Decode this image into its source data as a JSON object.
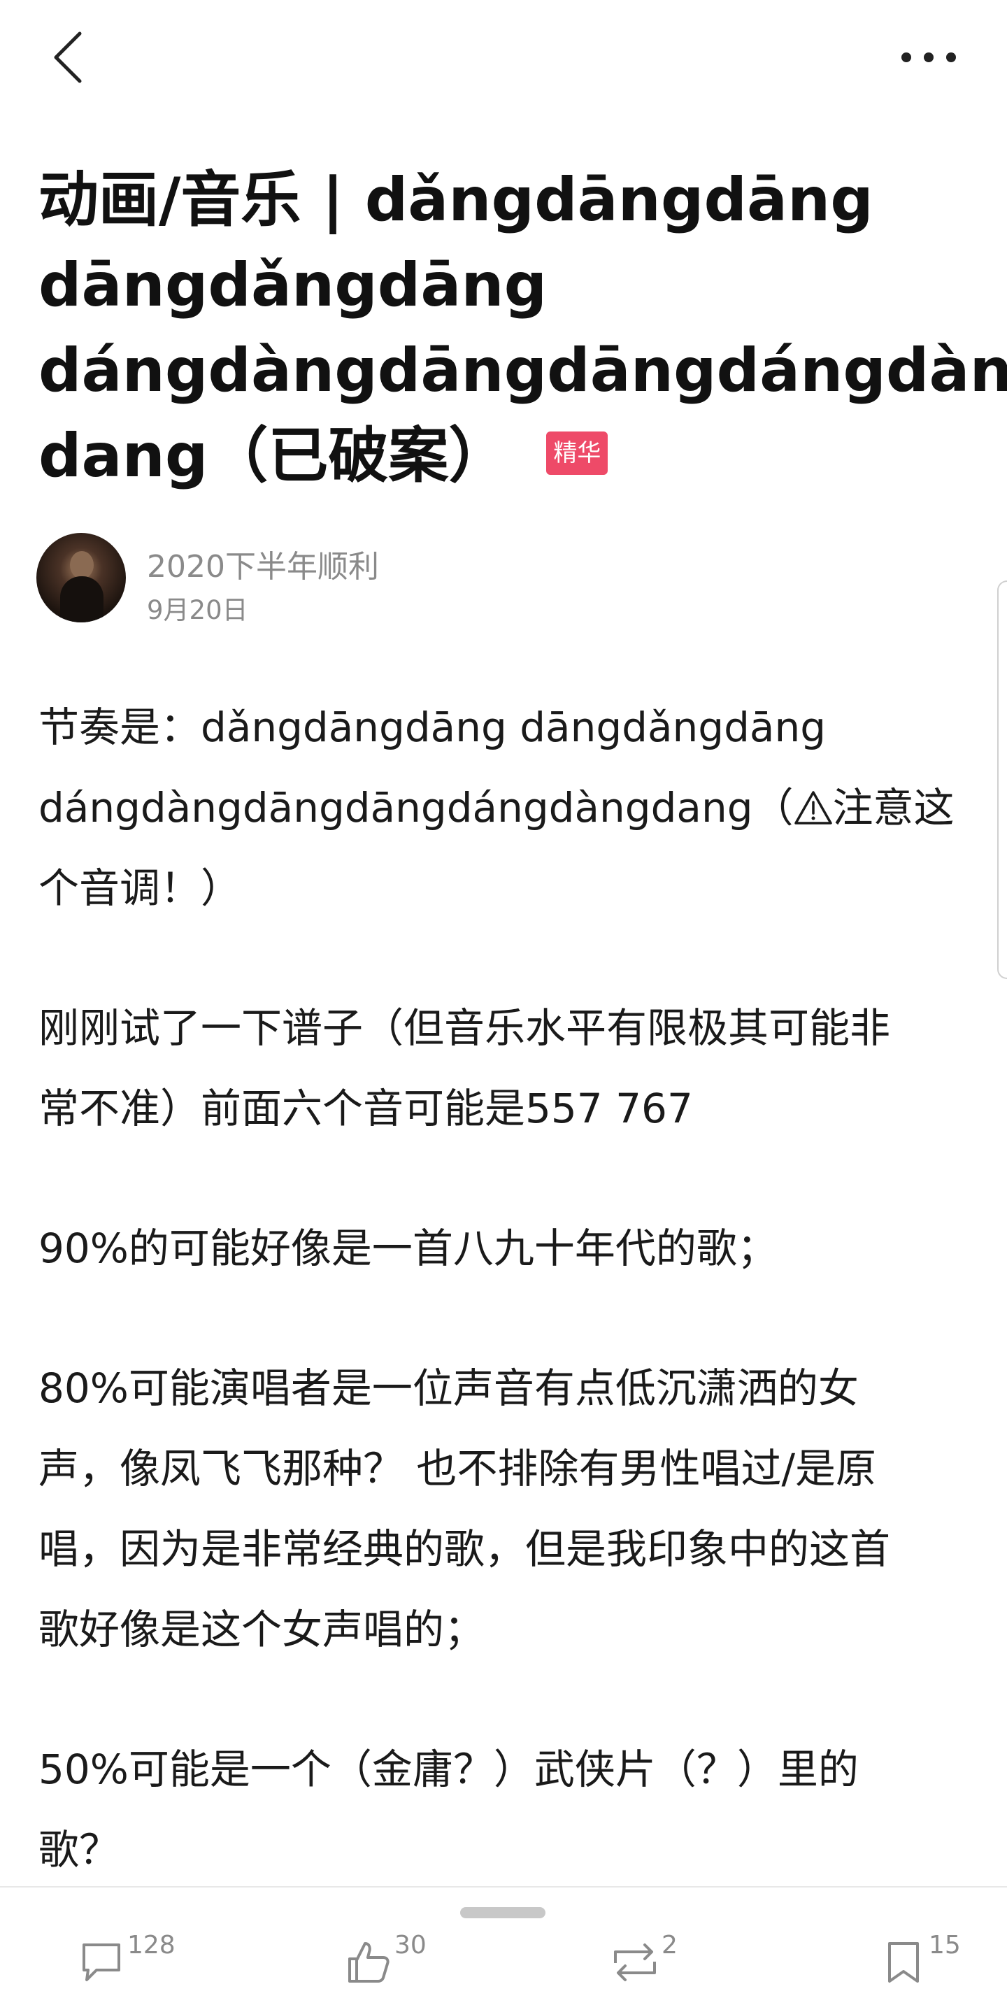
{
  "header": {
    "back_icon": "chevron-left-icon",
    "more_icon": "more-horizontal-icon"
  },
  "post": {
    "title_lines": [
      "动画/音乐 | dǎngdāngdāng",
      "dāngdǎngdāng",
      "dángdàngdāngdāngdángdàng",
      "dang（已破案）"
    ],
    "badge": "精华",
    "badge_color": "#ee4a68",
    "author": {
      "name": "2020下半年顺利",
      "date": "9月20日"
    },
    "paragraphs": [
      {
        "lines": [
          "节奏是：dǎngdāngdāng dāngdǎngdāng",
          "dángdàngdāngdāngdángdàngdang（",
          "注意这",
          "个音调！）"
        ]
      },
      {
        "lines": [
          "刚刚试了一下谱子（但音乐水平有限极其可能非",
          "常不准）前面六个音可能是557 767"
        ]
      },
      {
        "lines": [
          "90%的可能好像是一首八九十年代的歌；"
        ]
      },
      {
        "lines": [
          "80%可能演唱者是一位声音有点低沉潇洒的女",
          "声，像凤飞飞那种？ 也不排除有男性唱过/是原",
          "唱，因为是非常经典的歌，但是我印象中的这首",
          "歌好像是这个女声唱的；"
        ]
      },
      {
        "lines": [
          "50%可能是一个（金庸？）武侠片（？）里的",
          "歌？"
        ]
      }
    ]
  },
  "actions": {
    "comments": {
      "icon": "comment-icon",
      "count": "128"
    },
    "likes": {
      "icon": "thumbs-up-icon",
      "count": "30"
    },
    "reposts": {
      "icon": "repost-icon",
      "count": "2"
    },
    "favorites": {
      "icon": "bookmark-icon",
      "count": "15"
    }
  }
}
